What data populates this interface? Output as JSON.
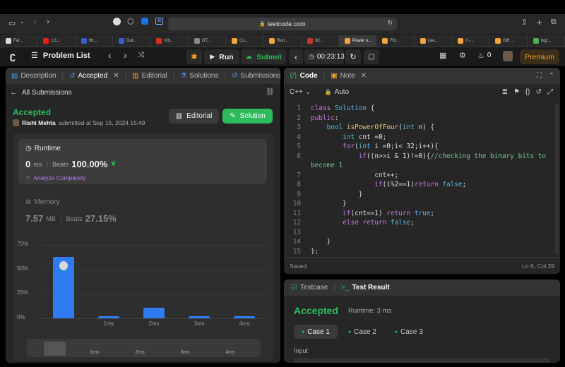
{
  "browser": {
    "url": "leetcode.com",
    "tabs": [
      {
        "label": "Fai...",
        "color": "#d9d9d9"
      },
      {
        "label": "(11...",
        "color": "#e62117"
      },
      {
        "label": "htt...",
        "color": "#3a5ccc"
      },
      {
        "label": "Dat...",
        "color": "#3a5ccc"
      },
      {
        "label": "Inb...",
        "color": "#d93025"
      },
      {
        "label": "OT...",
        "color": "#888888"
      },
      {
        "label": "Co...",
        "color": "#f2a33a"
      },
      {
        "label": "Ran...",
        "color": "#f2a33a"
      },
      {
        "label": "3C...",
        "color": "#c0392b"
      },
      {
        "label": "Power o...",
        "color": "#f2a33a"
      },
      {
        "label": "Fib...",
        "color": "#f2a33a"
      },
      {
        "label": "Lee...",
        "color": "#f2a33a"
      },
      {
        "label": "II -...",
        "color": "#f2a33a"
      },
      {
        "label": "Diff...",
        "color": "#f2a33a"
      },
      {
        "label": "log(...",
        "color": "#4caf50"
      }
    ]
  },
  "nav": {
    "problem_list": "Problem List",
    "run": "Run",
    "submit": "Submit",
    "timer": "00:23:13",
    "fire_count": "0",
    "premium": "Premium"
  },
  "left": {
    "tabs": {
      "description": "Description",
      "accepted": "Accepted",
      "editorial": "Editorial",
      "solutions": "Solutions",
      "submissions": "Submissions"
    },
    "all_submissions": "All Submissions",
    "status": "Accepted",
    "user": "Rishi Mehta",
    "submitted": "submitted at Sep 15, 2024 15:49",
    "editorial_btn": "Editorial",
    "solution_btn": "Solution",
    "runtime": {
      "title": "Runtime",
      "value": "0",
      "unit": "ms",
      "beats_label": "Beats",
      "beats": "100.00%",
      "analyze": "Analyze Complexity"
    },
    "memory": {
      "title": "Memory",
      "value": "7.57",
      "unit": "MB",
      "beats_label": "Beats",
      "beats": "27.15%"
    }
  },
  "chart_data": {
    "type": "bar",
    "categories": [
      "0ms",
      "1ms",
      "2ms",
      "3ms",
      "4ms"
    ],
    "x_tick_labels": [
      "",
      "1ms",
      "2ms",
      "3ms",
      "4ms"
    ],
    "values": [
      63,
      1.5,
      11,
      1.5,
      1.5
    ],
    "ylabel_ticks": [
      "75%",
      "50%",
      "25%",
      "0%"
    ],
    "ylim": [
      0,
      75
    ],
    "grid": true,
    "colors": {
      "bar": "#2f7bef"
    }
  },
  "editor": {
    "tab_code": "Code",
    "tab_note": "Note",
    "language": "C++",
    "mode": "Auto",
    "status": "Saved",
    "cursor": "Ln 6, Col 29",
    "line_numbers": [
      "1",
      "2",
      "3",
      "4",
      "5",
      "6",
      "",
      "7",
      "8",
      "9",
      "10",
      "11",
      "12",
      "13",
      "14",
      "15"
    ]
  },
  "testcase": {
    "tab_testcase": "Testcase",
    "tab_result": "Test Result",
    "result": "Accepted",
    "runtime": "Runtime: 3 ms",
    "cases": [
      "Case 1",
      "Case 2",
      "Case 3"
    ],
    "input_label": "Input"
  }
}
